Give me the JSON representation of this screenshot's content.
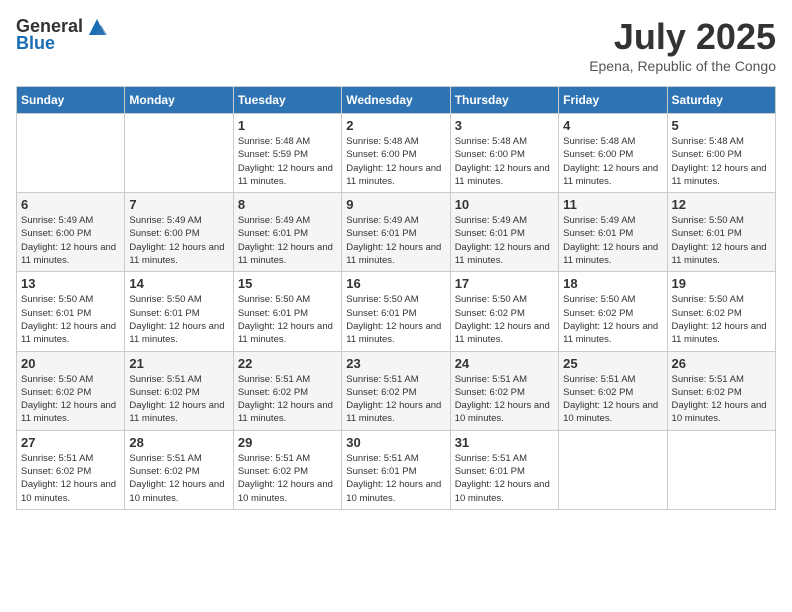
{
  "logo": {
    "general": "General",
    "blue": "Blue"
  },
  "title": {
    "month": "July 2025",
    "location": "Epena, Republic of the Congo"
  },
  "weekdays": [
    "Sunday",
    "Monday",
    "Tuesday",
    "Wednesday",
    "Thursday",
    "Friday",
    "Saturday"
  ],
  "weeks": [
    [
      {
        "day": "",
        "info": ""
      },
      {
        "day": "",
        "info": ""
      },
      {
        "day": "1",
        "info": "Sunrise: 5:48 AM\nSunset: 5:59 PM\nDaylight: 12 hours and 11 minutes."
      },
      {
        "day": "2",
        "info": "Sunrise: 5:48 AM\nSunset: 6:00 PM\nDaylight: 12 hours and 11 minutes."
      },
      {
        "day": "3",
        "info": "Sunrise: 5:48 AM\nSunset: 6:00 PM\nDaylight: 12 hours and 11 minutes."
      },
      {
        "day": "4",
        "info": "Sunrise: 5:48 AM\nSunset: 6:00 PM\nDaylight: 12 hours and 11 minutes."
      },
      {
        "day": "5",
        "info": "Sunrise: 5:48 AM\nSunset: 6:00 PM\nDaylight: 12 hours and 11 minutes."
      }
    ],
    [
      {
        "day": "6",
        "info": "Sunrise: 5:49 AM\nSunset: 6:00 PM\nDaylight: 12 hours and 11 minutes."
      },
      {
        "day": "7",
        "info": "Sunrise: 5:49 AM\nSunset: 6:00 PM\nDaylight: 12 hours and 11 minutes."
      },
      {
        "day": "8",
        "info": "Sunrise: 5:49 AM\nSunset: 6:01 PM\nDaylight: 12 hours and 11 minutes."
      },
      {
        "day": "9",
        "info": "Sunrise: 5:49 AM\nSunset: 6:01 PM\nDaylight: 12 hours and 11 minutes."
      },
      {
        "day": "10",
        "info": "Sunrise: 5:49 AM\nSunset: 6:01 PM\nDaylight: 12 hours and 11 minutes."
      },
      {
        "day": "11",
        "info": "Sunrise: 5:49 AM\nSunset: 6:01 PM\nDaylight: 12 hours and 11 minutes."
      },
      {
        "day": "12",
        "info": "Sunrise: 5:50 AM\nSunset: 6:01 PM\nDaylight: 12 hours and 11 minutes."
      }
    ],
    [
      {
        "day": "13",
        "info": "Sunrise: 5:50 AM\nSunset: 6:01 PM\nDaylight: 12 hours and 11 minutes."
      },
      {
        "day": "14",
        "info": "Sunrise: 5:50 AM\nSunset: 6:01 PM\nDaylight: 12 hours and 11 minutes."
      },
      {
        "day": "15",
        "info": "Sunrise: 5:50 AM\nSunset: 6:01 PM\nDaylight: 12 hours and 11 minutes."
      },
      {
        "day": "16",
        "info": "Sunrise: 5:50 AM\nSunset: 6:01 PM\nDaylight: 12 hours and 11 minutes."
      },
      {
        "day": "17",
        "info": "Sunrise: 5:50 AM\nSunset: 6:02 PM\nDaylight: 12 hours and 11 minutes."
      },
      {
        "day": "18",
        "info": "Sunrise: 5:50 AM\nSunset: 6:02 PM\nDaylight: 12 hours and 11 minutes."
      },
      {
        "day": "19",
        "info": "Sunrise: 5:50 AM\nSunset: 6:02 PM\nDaylight: 12 hours and 11 minutes."
      }
    ],
    [
      {
        "day": "20",
        "info": "Sunrise: 5:50 AM\nSunset: 6:02 PM\nDaylight: 12 hours and 11 minutes."
      },
      {
        "day": "21",
        "info": "Sunrise: 5:51 AM\nSunset: 6:02 PM\nDaylight: 12 hours and 11 minutes."
      },
      {
        "day": "22",
        "info": "Sunrise: 5:51 AM\nSunset: 6:02 PM\nDaylight: 12 hours and 11 minutes."
      },
      {
        "day": "23",
        "info": "Sunrise: 5:51 AM\nSunset: 6:02 PM\nDaylight: 12 hours and 11 minutes."
      },
      {
        "day": "24",
        "info": "Sunrise: 5:51 AM\nSunset: 6:02 PM\nDaylight: 12 hours and 10 minutes."
      },
      {
        "day": "25",
        "info": "Sunrise: 5:51 AM\nSunset: 6:02 PM\nDaylight: 12 hours and 10 minutes."
      },
      {
        "day": "26",
        "info": "Sunrise: 5:51 AM\nSunset: 6:02 PM\nDaylight: 12 hours and 10 minutes."
      }
    ],
    [
      {
        "day": "27",
        "info": "Sunrise: 5:51 AM\nSunset: 6:02 PM\nDaylight: 12 hours and 10 minutes."
      },
      {
        "day": "28",
        "info": "Sunrise: 5:51 AM\nSunset: 6:02 PM\nDaylight: 12 hours and 10 minutes."
      },
      {
        "day": "29",
        "info": "Sunrise: 5:51 AM\nSunset: 6:02 PM\nDaylight: 12 hours and 10 minutes."
      },
      {
        "day": "30",
        "info": "Sunrise: 5:51 AM\nSunset: 6:01 PM\nDaylight: 12 hours and 10 minutes."
      },
      {
        "day": "31",
        "info": "Sunrise: 5:51 AM\nSunset: 6:01 PM\nDaylight: 12 hours and 10 minutes."
      },
      {
        "day": "",
        "info": ""
      },
      {
        "day": "",
        "info": ""
      }
    ]
  ]
}
